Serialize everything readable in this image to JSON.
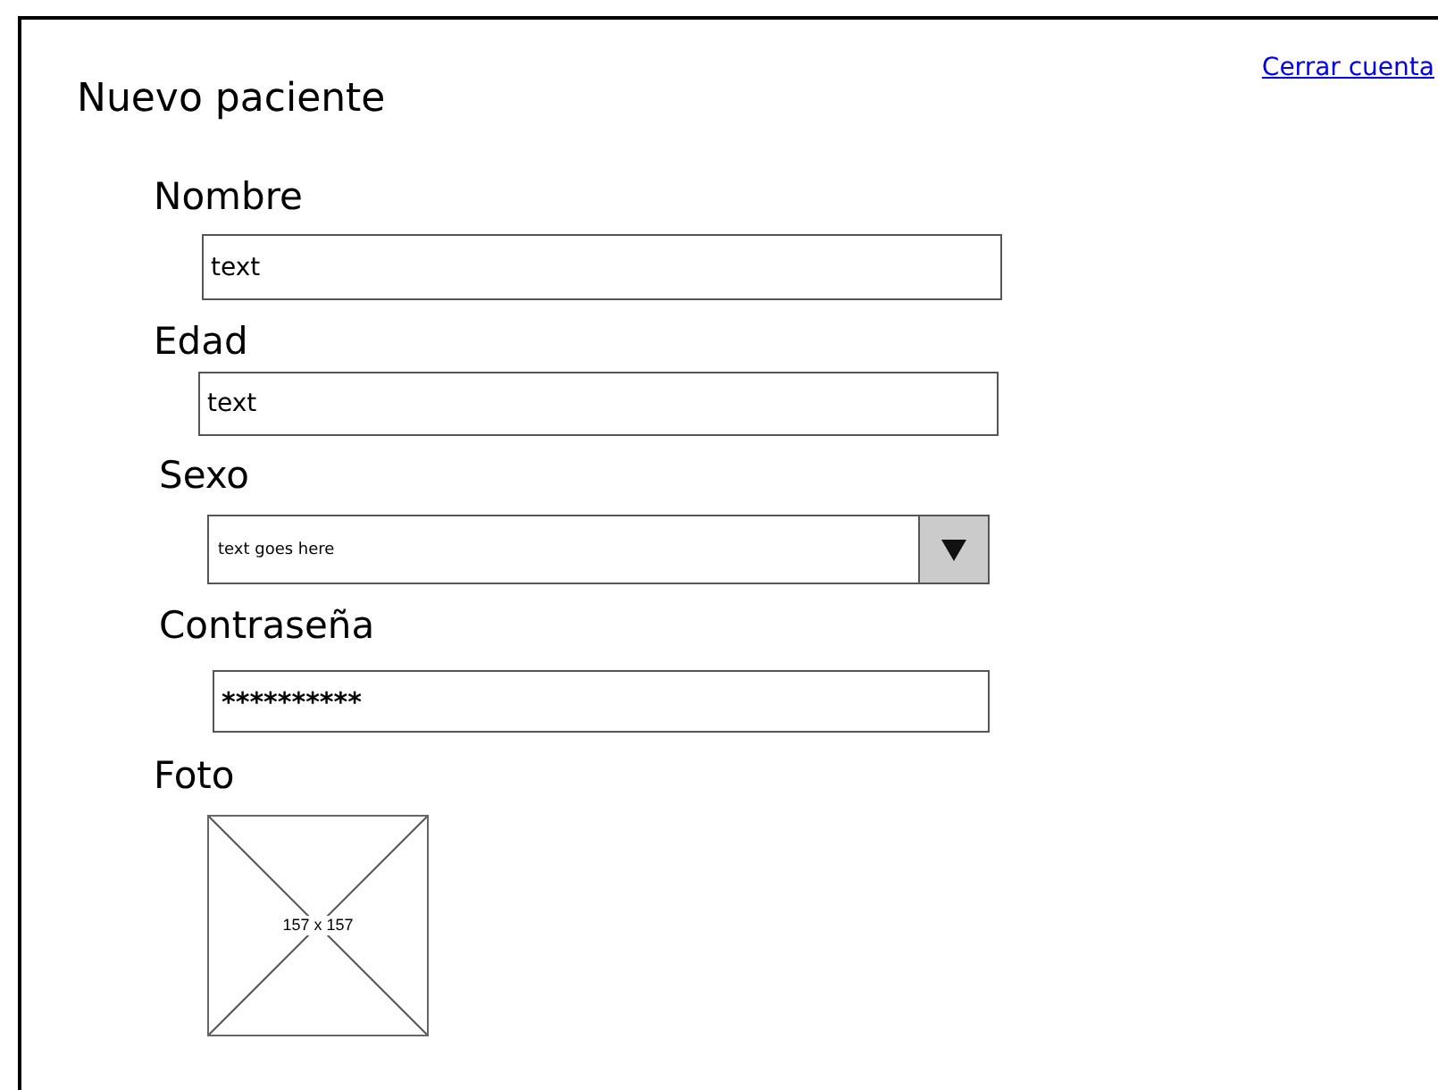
{
  "header": {
    "title": "Nuevo paciente",
    "link": "Cerrar cuenta"
  },
  "fields": [
    {
      "kind": "text",
      "label": "Nombre",
      "value": "text"
    },
    {
      "kind": "text",
      "label": "Edad",
      "value": "text"
    },
    {
      "kind": "select",
      "label": "Sexo",
      "value": "text goes here"
    },
    {
      "kind": "password",
      "label": "Contraseña",
      "value": "**********"
    },
    {
      "kind": "image",
      "label": "Foto",
      "caption": "157 x 157"
    }
  ]
}
